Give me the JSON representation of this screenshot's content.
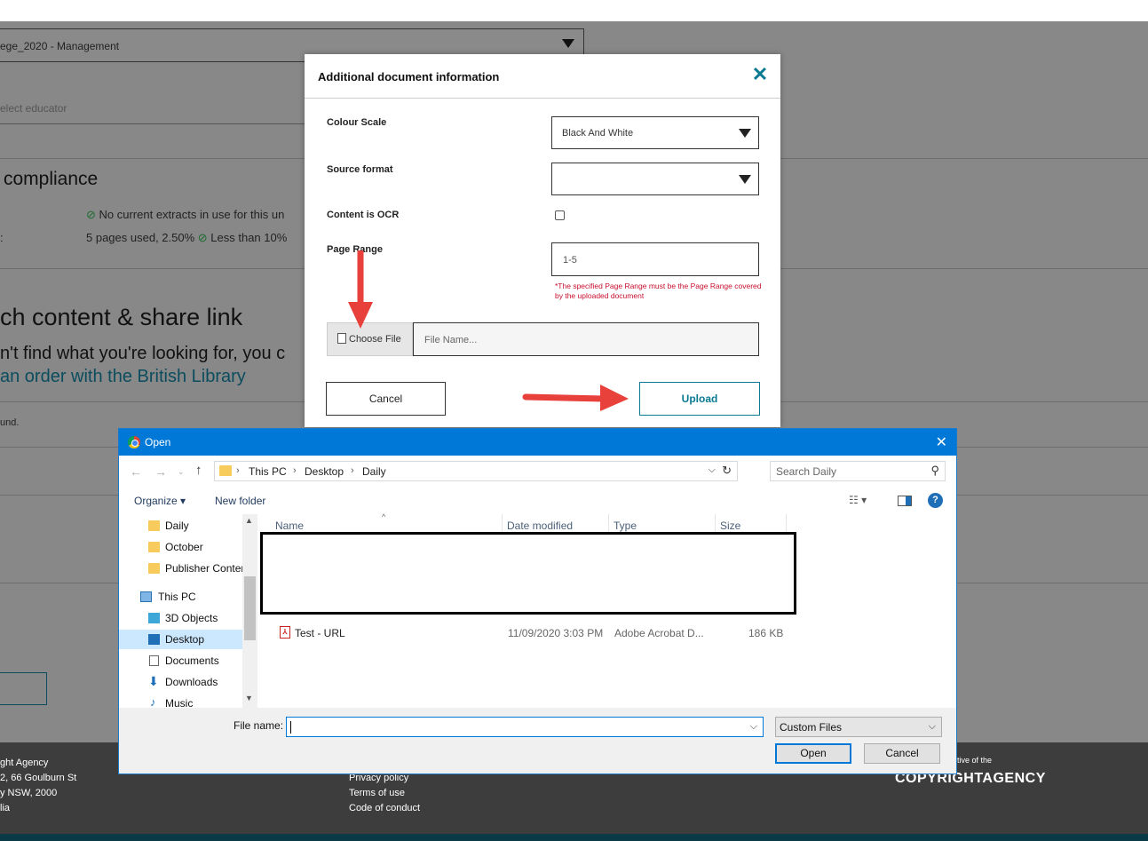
{
  "background": {
    "program_select": "ege_2020 - Management",
    "educator_placeholder": "elect educator",
    "compliance_heading": "compliance",
    "no_extracts": "No current extracts in use for this un",
    "pages_label": ":",
    "pages_used": "5 pages used, 2.50%",
    "less_than": "Less than 10%",
    "attach_heading": "ch content & share link",
    "cant_find": "n't find what you're looking for, you c",
    "order_link": "an order with the British Library",
    "found_text": "und."
  },
  "footer": {
    "address": [
      "ght Agency",
      "2, 66 Goulburn St",
      "y NSW, 2000",
      "lia"
    ],
    "links": [
      "Privacy policy",
      "Terms of use",
      "Code of conduct"
    ],
    "initiative": "tive of the",
    "logo": "COPYRIGHTAGENCY"
  },
  "modal": {
    "title": "Additional document information",
    "close_icon": "close-icon",
    "colour_scale_label": "Colour Scale",
    "colour_scale_value": "Black And White",
    "source_format_label": "Source format",
    "source_format_value": "",
    "ocr_label": "Content is OCR",
    "ocr_checked": false,
    "page_range_label": "Page Range",
    "page_range_value": "1-5",
    "page_range_note": "*The specified Page Range must be the Page Range covered by the uploaded document",
    "choose_file_label": "Choose File",
    "file_name_placeholder": "File Name...",
    "cancel_label": "Cancel",
    "upload_label": "Upload",
    "accent_color": "#0a7a91"
  },
  "dialog": {
    "title": "Open",
    "breadcrumb": [
      "This PC",
      "Desktop",
      "Daily"
    ],
    "search_placeholder": "Search Daily",
    "organize_label": "Organize ▾",
    "new_folder_label": "New folder",
    "help_label": "?",
    "nav_items": [
      {
        "label": "Daily",
        "icon": "folder-icon"
      },
      {
        "label": "October",
        "icon": "folder-sync-icon"
      },
      {
        "label": "Publisher Conter",
        "icon": "folder-icon"
      },
      {
        "label": "This PC",
        "icon": "computer-icon"
      },
      {
        "label": "3D Objects",
        "icon": "cube-icon"
      },
      {
        "label": "Desktop",
        "icon": "desktop-icon",
        "selected": true
      },
      {
        "label": "Documents",
        "icon": "documents-icon"
      },
      {
        "label": "Downloads",
        "icon": "download-icon"
      },
      {
        "label": "Music",
        "icon": "music-icon"
      }
    ],
    "columns": [
      "Name",
      "Date modified",
      "Type",
      "Size"
    ],
    "files": [
      {
        "name": "Test - URL",
        "date": "11/09/2020 3:03 PM",
        "type": "Adobe Acrobat D...",
        "size": "186 KB"
      }
    ],
    "file_name_label": "File name:",
    "file_name_value": "",
    "file_type": "Custom Files",
    "open_label": "Open",
    "cancel_label": "Cancel",
    "accent_color": "#0078d7"
  }
}
